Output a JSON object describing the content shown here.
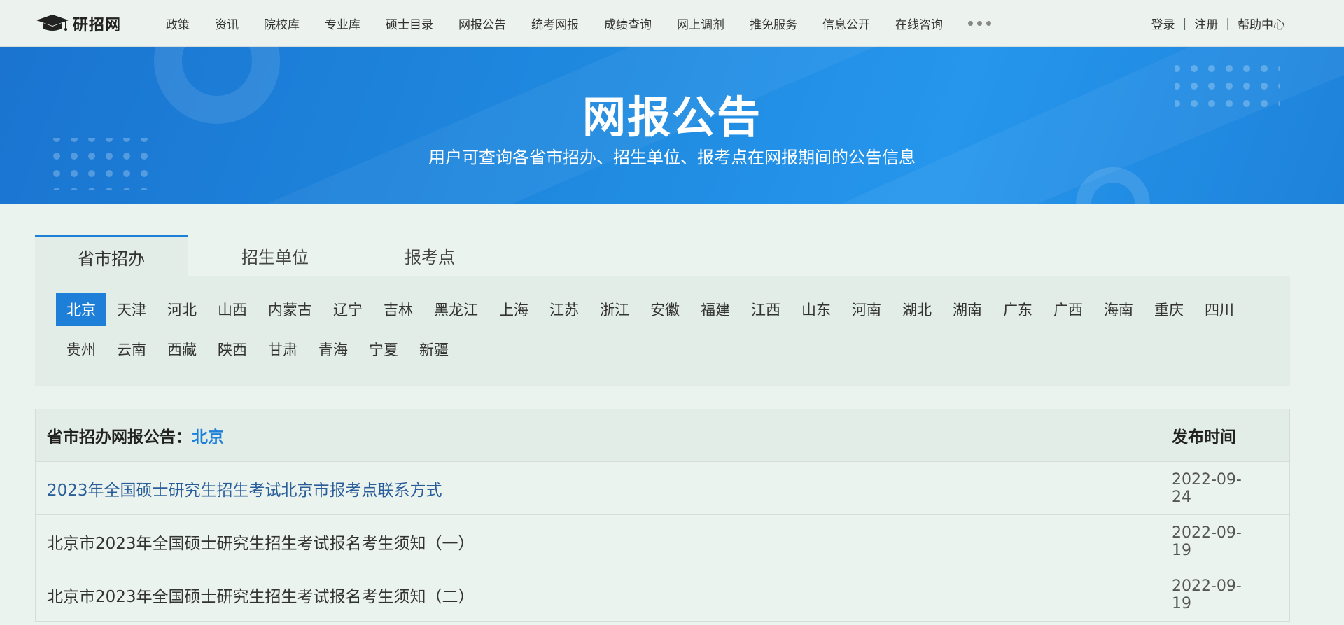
{
  "site": {
    "logo_text": "研招网"
  },
  "nav": {
    "items": [
      "政策",
      "资讯",
      "院校库",
      "专业库",
      "硕士目录",
      "网报公告",
      "统考网报",
      "成绩查询",
      "网上调剂",
      "推免服务",
      "信息公开",
      "在线咨询"
    ],
    "more_icon": "ellipsis-icon"
  },
  "user_links": {
    "login": "登录",
    "register": "注册",
    "help": "帮助中心",
    "separator": "|"
  },
  "banner": {
    "title": "网报公告",
    "subtitle": "用户可查询各省市招办、招生单位、报考点在网报期间的公告信息"
  },
  "tabs": [
    {
      "label": "省市招办",
      "active": true
    },
    {
      "label": "招生单位",
      "active": false
    },
    {
      "label": "报考点",
      "active": false
    }
  ],
  "provinces": {
    "items": [
      "北京",
      "天津",
      "河北",
      "山西",
      "内蒙古",
      "辽宁",
      "吉林",
      "黑龙江",
      "上海",
      "江苏",
      "浙江",
      "安徽",
      "福建",
      "江西",
      "山东",
      "河南",
      "湖北",
      "湖南",
      "广东",
      "广西",
      "海南",
      "重庆",
      "四川",
      "贵州",
      "云南",
      "西藏",
      "陕西",
      "甘肃",
      "青海",
      "宁夏",
      "新疆"
    ],
    "selected": "北京"
  },
  "list": {
    "caption_prefix": "省市招办网报公告：",
    "caption_city": "北京",
    "date_header": "发布时间",
    "rows": [
      {
        "title": "2023年全国硕士研究生招生考试北京市报考点联系方式",
        "date": "2022-09-24"
      },
      {
        "title": "北京市2023年全国硕士研究生招生考试报名考生须知（一）",
        "date": "2022-09-19"
      },
      {
        "title": "北京市2023年全国硕士研究生招生考试报名考生须知（二）",
        "date": "2022-09-19"
      }
    ]
  },
  "colors": {
    "accent": "#1e7fd8",
    "banner": "#1f8ae0",
    "page_bg": "#ebf3ee",
    "panel_bg": "#e3ede7"
  }
}
